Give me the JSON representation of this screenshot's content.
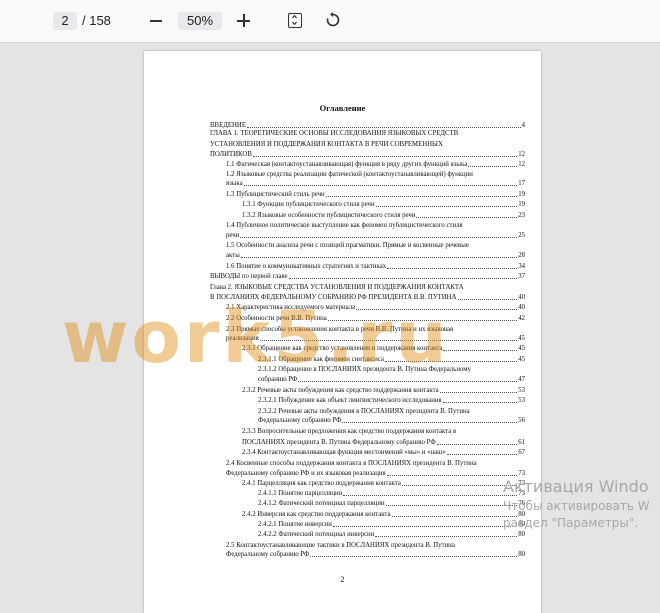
{
  "toolbar": {
    "page_current": "2",
    "page_total": "/ 158",
    "zoom": "50%"
  },
  "document": {
    "title": "Оглавление",
    "page_number": "2",
    "toc": [
      {
        "text": "ВВЕДЕНИЕ",
        "page": "4"
      },
      {
        "text": "ГЛАВА 1.   ТЕОРЕТИЧЕСКИЕ ОСНОВЫ ИССЛЕДОВАНИЯ ЯЗЫКОВЫХ СРЕДСТВ",
        "page": ""
      },
      {
        "text": "УСТАНОВЛЕНИЯ И ПОДДЕРЖАНИЯ КОНТАКТА В РЕЧИ СОВРЕМЕННЫХ",
        "page": ""
      },
      {
        "text": "ПОЛИТИКОВ",
        "page": "12"
      },
      {
        "text": "1.1 Фатическая (контактоустанавливающая) функция в ряду других функций языка",
        "page": "12"
      },
      {
        "text": "1.2 Языковые средства реализации фатической (контактоустанавливающей) функции",
        "page": ""
      },
      {
        "text": "языка",
        "page": "17"
      },
      {
        "text": "1.3 Публицистический стиль речи",
        "page": "19"
      },
      {
        "text": "1.3.1 Функции публицистического стиля речи",
        "page": "19"
      },
      {
        "text": "1.3.2 Языковые особенности публицистического стиля речи",
        "page": "23"
      },
      {
        "text": "1.4 Публичное политическое выступление как феномен публицистического стиля",
        "page": ""
      },
      {
        "text": "речи",
        "page": "25"
      },
      {
        "text": "1.5 Особенности анализа речи с позиций прагматики. Прямые и косвенные речевые",
        "page": ""
      },
      {
        "text": "акты",
        "page": "28"
      },
      {
        "text": "1.6 Понятие о коммуникативных стратегиях и тактиках",
        "page": "34"
      },
      {
        "text": "ВЫВОДЫ по первой главе",
        "page": "37"
      },
      {
        "text": "Глава 2.    ЯЗЫКОВЫЕ СРЕДСТВА УСТАНОВЛЕНИЯ И ПОДДЕРЖАНИЯ КОНТАКТА",
        "page": ""
      },
      {
        "text": "В ПОСЛАНИЯХ ФЕДЕРАЛЬНОМУ СОБРАНИЮ РФ ПРЕЗИДЕНТА В.В. ПУТИНА",
        "page": "40"
      },
      {
        "text": "2.1 Характеристика исследуемого материала",
        "page": "40"
      },
      {
        "text": "2.2 Особенности речи В.В. Путина",
        "page": "42"
      },
      {
        "text": "2.3 Прямые способы установления контакта в речи В.В. Путина и их языковая",
        "page": ""
      },
      {
        "text": "реализация",
        "page": "45"
      },
      {
        "text": "2.3.1 Обращение как средство установления и поддержания контакта",
        "page": "45"
      },
      {
        "text": "2.3.1.1 Обращение как феномен синтаксиса",
        "page": "45"
      },
      {
        "text": "2.3.1.2 Обращение в ПОСЛАНИЯХ президента В. Путина Федеральному",
        "page": ""
      },
      {
        "text": "собранию РФ",
        "page": "47"
      },
      {
        "text": "2.3.2 Речевые акты побуждения как средство поддержания контакта",
        "page": "53"
      },
      {
        "text": "2.3.2.1 Побуждение как объект лингвистического исследования",
        "page": "53"
      },
      {
        "text": "2.3.2.2 Речевые акты побуждения в ПОСЛАНИЯХ президента В. Путина",
        "page": ""
      },
      {
        "text": "Федеральному собранию РФ",
        "page": "56"
      },
      {
        "text": "2.3.3 Вопросительные предложения как средство поддержания контакта в",
        "page": ""
      },
      {
        "text": "ПОСЛАНИЯХ президента В. Путина Федеральному собранию РФ",
        "page": "61"
      },
      {
        "text": "2.3.4 Контактоустанавливающая функция местоимений «мы» и «наш»",
        "page": "67"
      },
      {
        "text": "2.4 Косвенные способы поддержания контакта в ПОСЛАНИЯХ президента В. Путина",
        "page": ""
      },
      {
        "text": "Федеральному собранию РФ и их языковая реализация",
        "page": "73"
      },
      {
        "text": "2.4.1 Парцелляция как средство поддержания контакта",
        "page": "73"
      },
      {
        "text": "2.4.1.1 Понятие парцелляции",
        "page": "73"
      },
      {
        "text": "2.4.1.2 Фатический потенциал парцелляции",
        "page": "76"
      },
      {
        "text": "2.4.2 Инверсия как средство поддержания контакта",
        "page": "80"
      },
      {
        "text": "2.4.2.1 Понятие инверсии",
        "page": "80"
      },
      {
        "text": "2.4.2.2 Фатический потенциал инверсии",
        "page": "80"
      },
      {
        "text": "2.5 Контактоустанавливающие тактики в ПОСЛАНИЯХ президента В. Путина",
        "page": ""
      },
      {
        "text": "Федеральному собранию РФ",
        "page": "80"
      }
    ]
  },
  "watermark": "work5.ru",
  "activation": {
    "title": "Активация Windo",
    "line1": "Чтобы активировать W",
    "line2": "раздел \"Параметры\"."
  }
}
